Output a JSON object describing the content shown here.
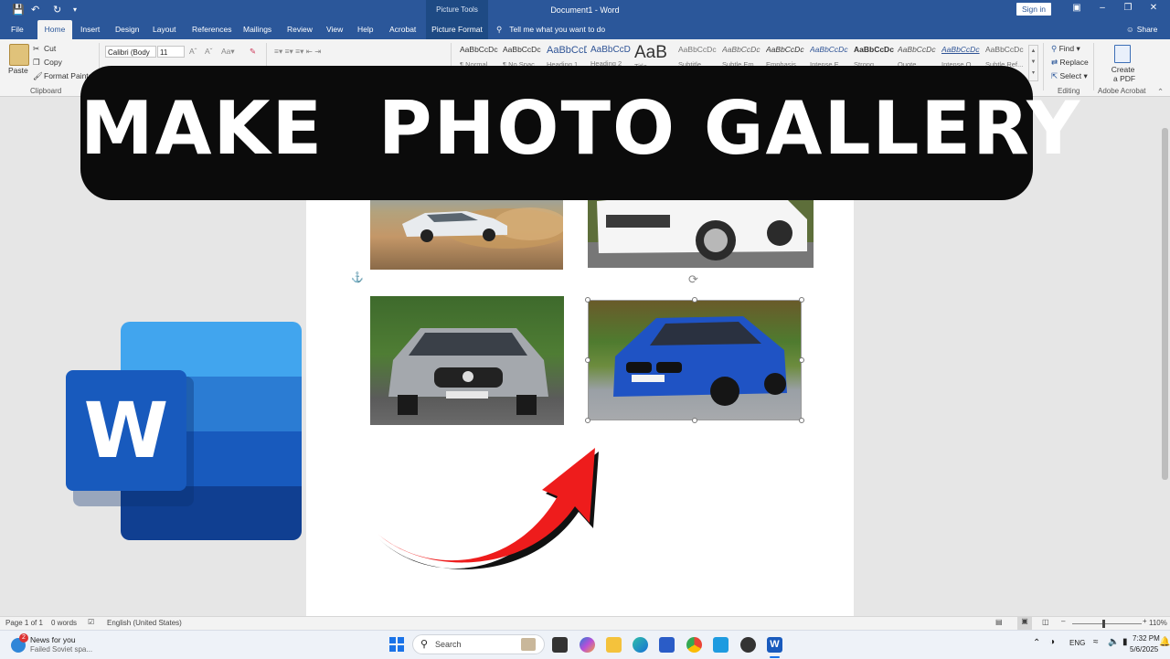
{
  "window": {
    "title": "Document1 - Word",
    "context_tab_group": "Picture Tools",
    "sign_in": "Sign in",
    "qat_icons": [
      "save-icon",
      "undo-icon",
      "redo-icon",
      "customize-icon"
    ]
  },
  "tabs": [
    "File",
    "Home",
    "Insert",
    "Design",
    "Layout",
    "References",
    "Mailings",
    "Review",
    "View",
    "Help",
    "Acrobat",
    "Picture Format"
  ],
  "active_tab": "Home",
  "tell_me": "Tell me what you want to do",
  "share": "Share",
  "ribbon": {
    "clipboard": {
      "paste": "Paste",
      "cut": "Cut",
      "copy": "Copy",
      "format_painter": "Format Painter",
      "label": "Clipboard"
    },
    "font": {
      "name": "Calibri (Body",
      "size": "11"
    },
    "styles": [
      {
        "preview": "AaBbCcDc",
        "name": "¶ Normal"
      },
      {
        "preview": "AaBbCcDc",
        "name": "¶ No Spac..."
      },
      {
        "preview": "AaBbCcD",
        "name": "Heading 1"
      },
      {
        "preview": "AaBbCcD",
        "name": "Heading 2"
      },
      {
        "preview": "AaB",
        "name": "Title"
      },
      {
        "preview": "AaBbCcDc",
        "name": "Subtitle"
      },
      {
        "preview": "AaBbCcDc",
        "name": "Subtle Em..."
      },
      {
        "preview": "AaBbCcDc",
        "name": "Emphasis"
      },
      {
        "preview": "AaBbCcDc",
        "name": "Intense E..."
      },
      {
        "preview": "AaBbCcDc",
        "name": "Strong"
      },
      {
        "preview": "AaBbCcDc",
        "name": "Quote"
      },
      {
        "preview": "AaBbCcDc",
        "name": "Intense Q..."
      },
      {
        "preview": "AaBbCcDc",
        "name": "Subtle Ref..."
      }
    ],
    "editing": {
      "find": "Find",
      "replace": "Replace",
      "select": "Select",
      "label": "Editing"
    },
    "acrobat": {
      "create_pdf_line1": "Create",
      "create_pdf_line2": "a PDF",
      "label": "Adobe Acrobat"
    }
  },
  "banner": {
    "text": "MAKE  PHOTO GALLERY"
  },
  "photos": [
    {
      "subject": "white BMW sedan drifting on dirt",
      "colors": [
        "#7a5a3a",
        "#c9a070",
        "#e8e8ea"
      ]
    },
    {
      "subject": "white Range Rover Evoque",
      "colors": [
        "#6a7a3c",
        "#f4f4f4",
        "#3a3a3a"
      ]
    },
    {
      "subject": "silver Mercedes-AMG GT",
      "colors": [
        "#3c6a2a",
        "#9a9ea4",
        "#d8d8d8"
      ]
    },
    {
      "subject": "blue BMW 3 Series GT",
      "colors": [
        "#5a7a3a",
        "#1d4fb8",
        "#9aa0a8"
      ]
    }
  ],
  "status": {
    "page": "Page 1 of 1",
    "words": "0 words",
    "language": "English (United States)",
    "zoom": "110%"
  },
  "taskbar": {
    "news_title": "News for you",
    "news_sub": "Failed Soviet spa...",
    "news_badge": "2",
    "search": "Search",
    "lang": "ENG",
    "time": "7:32 PM",
    "date": "5/6/2025"
  }
}
